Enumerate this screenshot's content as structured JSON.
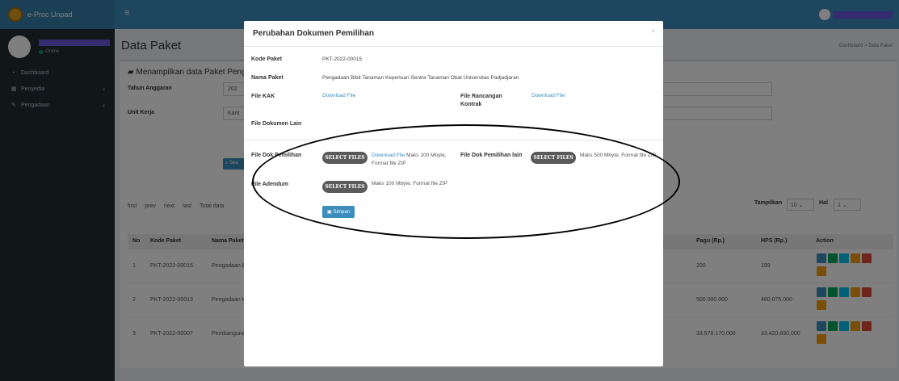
{
  "app": {
    "title": "e-Proc Unpad"
  },
  "sidebar": {
    "status": "Online",
    "items": [
      {
        "icon": "dashboard-icon",
        "label": "Dashboard",
        "chevron": ""
      },
      {
        "icon": "calendar-icon",
        "label": "Penyedia",
        "chevron": "‹"
      },
      {
        "icon": "edit-icon",
        "label": "Pengadaan",
        "chevron": "‹"
      }
    ]
  },
  "page": {
    "title": "Data Paket",
    "breadcrumb": [
      "Dashboard",
      "Data Paket"
    ],
    "box_title": "Menampilkan data Paket Penga",
    "tahun_label": "Tahun Anggaran",
    "tahun_value": "202",
    "unit_label": "Unit Kerja",
    "unit_value": "Kant",
    "search_label": "Sea"
  },
  "pager": {
    "first": "first",
    "prev": "prev",
    "next": "next",
    "last": "last",
    "total": "Total data"
  },
  "tampilkan": {
    "label": "Tampilkan",
    "value": "10",
    "hal_label": "Hal",
    "hal_value": "1"
  },
  "table": {
    "headers": [
      "No",
      "Kode Paket",
      "Nama Paket",
      "Pagu (Rp.)",
      "HPS (Rp.)",
      "Action"
    ],
    "rows": [
      {
        "no": "1",
        "kode": "PKT-2022-00015",
        "nama": "Pengadaan Bibi",
        "pagu": "200",
        "hps": "199"
      },
      {
        "no": "2",
        "kode": "PKT-2022-00013",
        "nama": "Pengadaan Hol",
        "pagu": "500.000.000",
        "hps": "480.075.000"
      },
      {
        "no": "3",
        "kode": "PKT-2022-00007",
        "nama": "Pembangunan",
        "pagu": "33.578.170.000",
        "hps": "33.420.830.000"
      }
    ]
  },
  "modal": {
    "title": "Perubahan Dokumen Pemilihan",
    "close": "×",
    "kode_label": "Kode Paket",
    "kode_value": "PKT-2022-00015",
    "nama_label": "Nama Paket",
    "nama_value": "Pengadaan Bibit Tanaman Keperluan Sentra Tanaman Obat Universitas Padjadjaran",
    "kak_label": "File KAK",
    "kak_link": "Download File",
    "rancangan_label": "File Rancangan Kontrak",
    "rancangan_link": "Download File",
    "lain_label": "File Dokumen Lain",
    "dok_pemilihan_label": "File Dok Pemilihan",
    "select_files": "SELECT FILES",
    "dok_pemilihan_link": "Download File",
    "dok_pemilihan_note": "Maks 100 Mbyte, Format file ZIP",
    "dok_pemilihan_lain_label": "File Dok Pemilihan lain",
    "dok_pemilihan_lain_note": "Maks 500 Mbyte, Format file ZIP",
    "adendum_label": "File Adendum",
    "adendum_note": "Maks 100 Mbyte, Format file ZIP",
    "simpan": "Simpan"
  },
  "colors": {
    "header": "#3c8dbc",
    "sidebar": "#222d32",
    "action_blue": "#3c8dbc",
    "action_green": "#00a65a",
    "action_teal": "#00c0ef",
    "action_orange": "#f39c12",
    "action_red": "#dd4b39"
  }
}
